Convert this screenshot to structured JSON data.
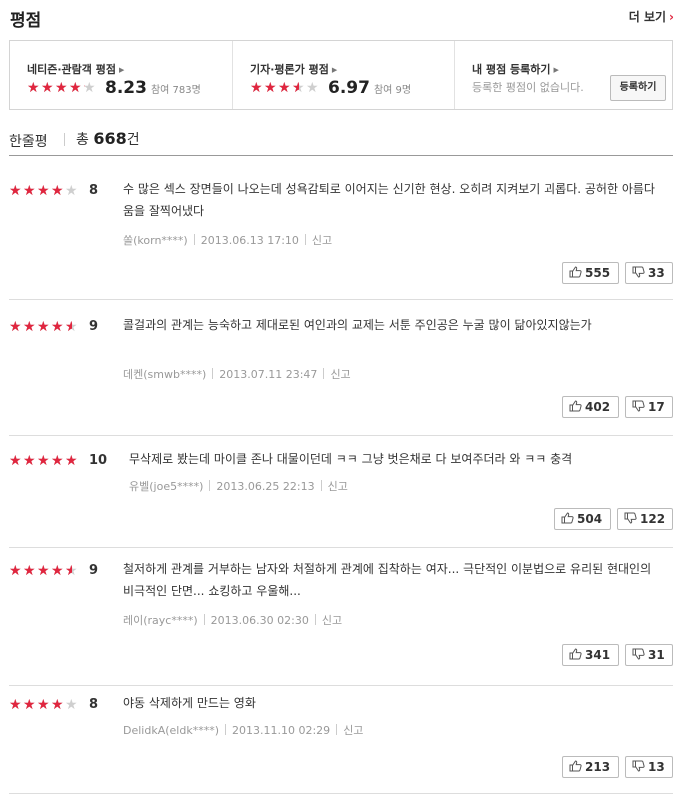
{
  "header": {
    "title": "평점",
    "more": "더 보기"
  },
  "summary": {
    "netizen": {
      "label": "네티즌·관람객 평점",
      "rating": 8.23,
      "score": "8.23",
      "participants": "참여 783명"
    },
    "critic": {
      "label": "기자·평론가 평점",
      "rating": 6.97,
      "score": "6.97",
      "participants": "참여 9명"
    },
    "mine": {
      "label": "내 평점 등록하기",
      "desc": "등록한 평점이 없습니다.",
      "button": "등록하기"
    }
  },
  "oneline": {
    "label": "한줄평",
    "total_prefix": "총",
    "count": "668",
    "suffix": "건"
  },
  "report_label": "신고",
  "reviews": [
    {
      "score": "8",
      "rating": 8,
      "text": "수 많은 섹스 장면들이 나오는데 성욕감퇴로 이어지는 신기한 현상. 오히려 지켜보기 괴롭다. 공허한 아름다움을 잘찍어냈다",
      "user": "쏠(korn****)",
      "date": "2013.06.13 17:10",
      "likes": "555",
      "dislikes": "33"
    },
    {
      "score": "9",
      "rating": 9,
      "text": "콜걸과의 관계는 능숙하고 제대로된 여인과의 교제는 서툰 주인공은 누굴 많이 닮아있지않는가",
      "user": "데켄(smwb****)",
      "date": "2013.07.11 23:47",
      "likes": "402",
      "dislikes": "17"
    },
    {
      "score": "10",
      "rating": 10,
      "text": "무삭제로 봤는데 마이클 존나 대물이던데 ㅋㅋ 그냥 벗은채로 다 보여주더라 와 ㅋㅋ 충격",
      "user": "유벨(joe5****)",
      "date": "2013.06.25 22:13",
      "likes": "504",
      "dislikes": "122"
    },
    {
      "score": "9",
      "rating": 9,
      "text": "철저하게 관계를 거부하는 남자와 처절하게 관계에 집착하는 여자... 극단적인 이분법으로 유리된 현대인의 비극적인 단면... 쇼킹하고 우울해...",
      "user": "레이(rayc****)",
      "date": "2013.06.30 02:30",
      "likes": "341",
      "dislikes": "31"
    },
    {
      "score": "8",
      "rating": 8,
      "text": "야동 삭제하게 만드는 영화",
      "user": "DelidkA(eldk****)",
      "date": "2013.11.10 02:29",
      "likes": "213",
      "dislikes": "13"
    }
  ]
}
